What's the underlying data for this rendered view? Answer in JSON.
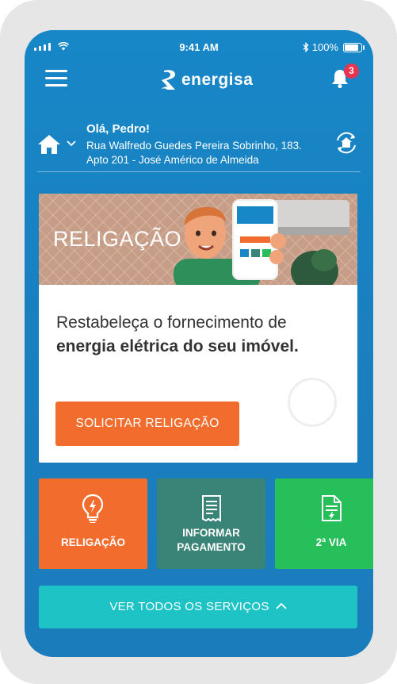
{
  "status_bar": {
    "time": "9:41 AM",
    "battery": "100%"
  },
  "header": {
    "logo_text": "energisa",
    "notification_count": "3"
  },
  "address": {
    "greeting": "Olá, Pedro!",
    "line1": "Rua Walfredo Guedes Pereira Sobrinho, 183.",
    "line2": "Apto 201 - José Américo de Almeida"
  },
  "hero": {
    "banner_title": "RELIGAÇÃO",
    "description_regular": "Restabeleça o fornecimento de",
    "description_bold": "energia elétrica do seu imóvel.",
    "button_label": "SOLICITAR RELIGAÇÃO"
  },
  "services": [
    {
      "label_line1": "RELIGAÇÃO",
      "label_line2": "",
      "icon": "lightbulb-icon",
      "color": "#f26d2d"
    },
    {
      "label_line1": "INFORMAR",
      "label_line2": "PAGAMENTO",
      "icon": "receipt-icon",
      "color": "#3a8377"
    },
    {
      "label_line1": "2ª VIA",
      "label_line2": "",
      "icon": "document-icon",
      "color": "#26bf5a"
    }
  ],
  "footer_button": {
    "label": "VER TODOS OS SERVIÇOS"
  },
  "colors": {
    "primary_blue": "#1787c7",
    "accent_orange": "#f26d2d",
    "teal": "#1ec3c6"
  }
}
